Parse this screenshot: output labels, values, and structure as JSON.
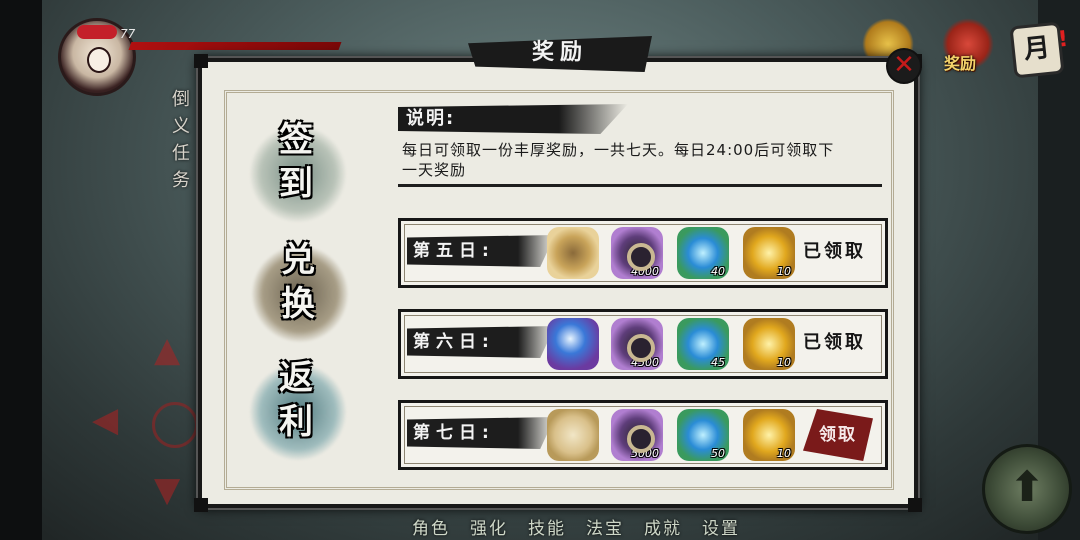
{
  "hud": {
    "level": "77",
    "side_text": "倒 义 任 务"
  },
  "top_icons": {
    "rewards_label": "奖励",
    "monthly_label": "月",
    "monthly_badge": "!"
  },
  "panel": {
    "title": "奖励",
    "close_symbol": "✕",
    "tabs": [
      {
        "label": "签到"
      },
      {
        "label": "兑换"
      },
      {
        "label": "返利"
      }
    ],
    "description": {
      "heading": "说明:",
      "text": "每日可领取一份丰厚奖励，一共七天。每日24:00后可领取下一天奖励"
    },
    "days": [
      {
        "label": "第五日:",
        "items": [
          {
            "icon": "bag-icon",
            "qty": ""
          },
          {
            "icon": "coin-icon",
            "qty": "4000"
          },
          {
            "icon": "blue-flame-icon",
            "qty": "40"
          },
          {
            "icon": "gold-ingot-icon",
            "qty": "10"
          }
        ],
        "status": "已领取"
      },
      {
        "label": "第六日:",
        "items": [
          {
            "icon": "blue-orb-icon",
            "qty": ""
          },
          {
            "icon": "coin-icon",
            "qty": "4500"
          },
          {
            "icon": "blue-flame-icon",
            "qty": "45"
          },
          {
            "icon": "gold-ingot-icon",
            "qty": "10"
          }
        ],
        "status": "已领取"
      },
      {
        "label": "第七日:",
        "items": [
          {
            "icon": "scroll-book-icon",
            "qty": ""
          },
          {
            "icon": "coin-icon",
            "qty": "5000"
          },
          {
            "icon": "blue-flame-icon",
            "qty": "50"
          },
          {
            "icon": "gold-ingot-icon",
            "qty": "10"
          }
        ],
        "action": "领取"
      }
    ]
  },
  "bottom_menu": [
    "角色",
    "强化",
    "技能",
    "法宝",
    "成就",
    "设置"
  ],
  "colors": {
    "panel_bg": "#ecebe3",
    "ink": "#1a1a1a",
    "claim_button": "#7a1a1a",
    "hp_bar": "#b01010"
  }
}
